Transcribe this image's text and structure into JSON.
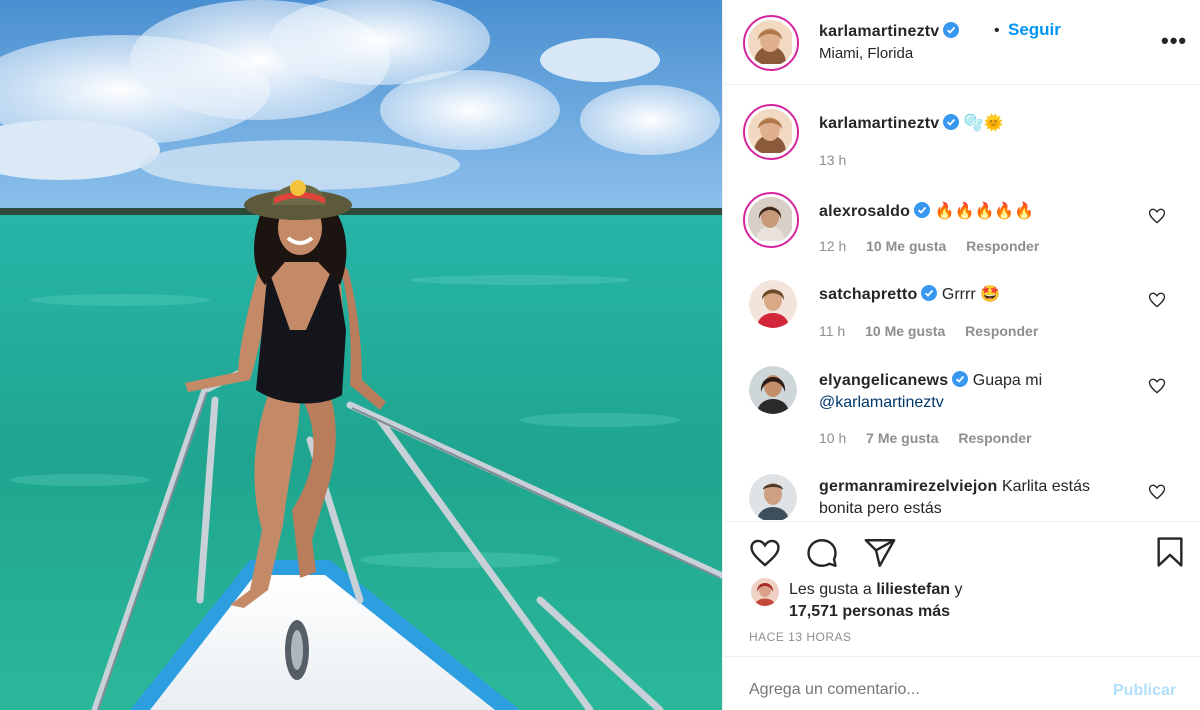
{
  "post": {
    "image_alt": "Woman in black swimsuit and hat on the bow of a boat over turquoise sea"
  },
  "header": {
    "username": "karlamartineztv",
    "separator": "•",
    "follow_label": "Seguir",
    "location": "Miami, Florida",
    "more_label": "•••"
  },
  "caption": {
    "username": "karlamartineztv",
    "text": "🫧🌞",
    "time": "13 h"
  },
  "comments": [
    {
      "username": "alexrosaldo",
      "text": "🔥🔥🔥🔥🔥",
      "time": "12 h",
      "likes": "10 Me gusta",
      "reply": "Responder"
    },
    {
      "username": "satchapretto",
      "text": "Grrrr 🤩",
      "time": "11 h",
      "likes": "10 Me gusta",
      "reply": "Responder"
    },
    {
      "username": "elyangelicanews",
      "text": "Guapa mi",
      "mention": "@karlamartineztv",
      "time": "10 h",
      "likes": "7 Me gusta",
      "reply": "Responder"
    },
    {
      "username": "germanramirezelviejon",
      "text": "Karlita estás bonita pero estás"
    }
  ],
  "likes": {
    "prefix": "Les gusta a",
    "user": "liliestefan",
    "joiner": "y",
    "count": "17,571 personas más"
  },
  "posted_ago": "HACE 13 HORAS",
  "add_comment": {
    "placeholder": "Agrega un comentario...",
    "publish_label": "Publicar"
  },
  "colors": {
    "accent": "#0095f6",
    "verified": "#3897f0",
    "muted": "#8e8e8e",
    "publish_disabled": "#b2dffc",
    "sea": "#1fb39a"
  },
  "icons": [
    "heart-icon",
    "comment-icon",
    "share-icon",
    "bookmark-icon",
    "verified-icon",
    "more-options-icon"
  ]
}
